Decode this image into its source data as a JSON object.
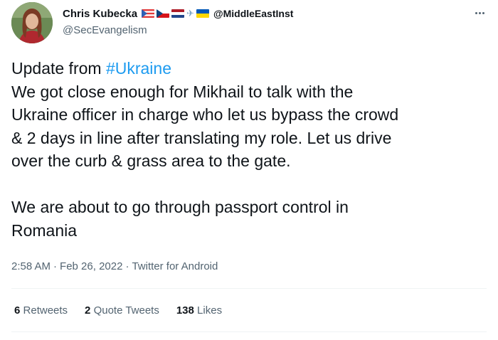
{
  "author": {
    "display_name": "Chris Kubecka",
    "flag_emojis": [
      "puerto-rico-flag",
      "czech-flag",
      "netherlands-flag",
      "airplane",
      "ukraine-flag"
    ],
    "mention": "@MiddleEastInst",
    "handle": "@SecEvangelism"
  },
  "tweet": {
    "line1_prefix": "Update from ",
    "hashtag": "#Ukraine",
    "line2": "We got close enough for Mikhail to talk with the",
    "line3": "Ukraine officer in charge who let us bypass the crowd",
    "line4": "& 2 days in line after translating my role.  Let us drive",
    "line5": "over the curb & grass area to the gate.",
    "line6": "We are about to go through passport control in",
    "line7": "Romania"
  },
  "meta": {
    "time": "2:58 AM",
    "separator": "·",
    "date": "Feb 26, 2022",
    "source": "Twitter for Android"
  },
  "stats": {
    "retweets_count": "6",
    "retweets_label": "Retweets",
    "quotes_count": "2",
    "quotes_label": "Quote Tweets",
    "likes_count": "138",
    "likes_label": "Likes"
  },
  "colors": {
    "hashtag": "#1d9bf0",
    "secondary_text": "#536471",
    "primary_text": "#0f1419"
  }
}
